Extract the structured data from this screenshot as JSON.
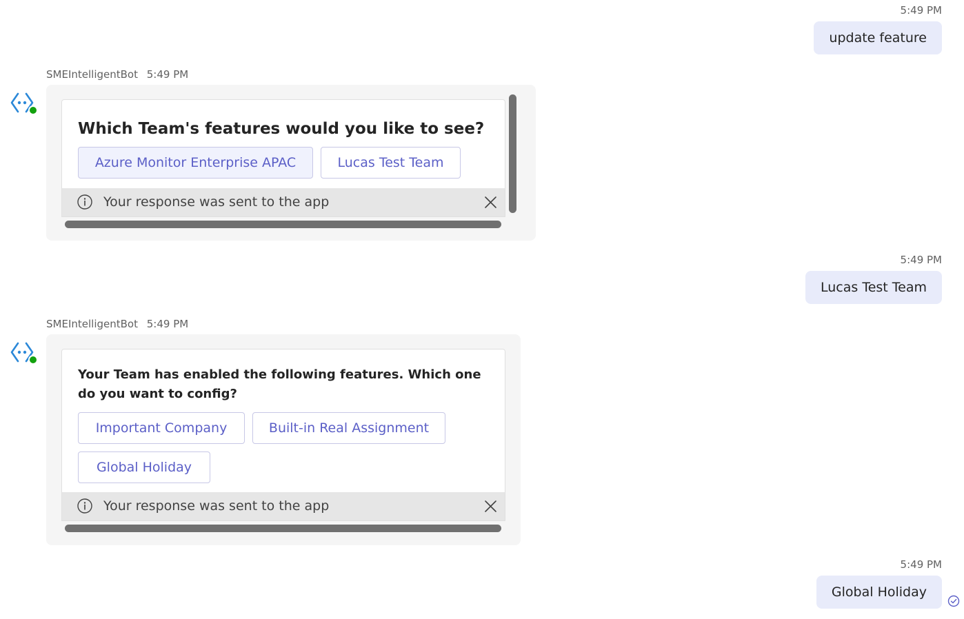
{
  "messages": [
    {
      "time": "5:49 PM",
      "text": "update feature"
    },
    {
      "time": "5:49 PM",
      "text": "Lucas Test Team"
    },
    {
      "time": "5:49 PM",
      "text": "Global Holiday"
    }
  ],
  "bot_cards": [
    {
      "sender": "SMEIntelligentBot",
      "time": "5:49 PM",
      "title": "Which Team's features would you like to see?",
      "buttons": [
        "Azure Monitor Enterprise APAC",
        "Lucas Test Team"
      ],
      "notice": "Your response was sent to the app"
    },
    {
      "sender": "SMEIntelligentBot",
      "time": "5:49 PM",
      "title": "Your Team has enabled the following features. Which one do you want to config?",
      "buttons": [
        "Important Company",
        "Built-in Real Assignment",
        "Global Holiday"
      ],
      "notice": "Your response was sent to the app"
    }
  ],
  "colors": {
    "bubble_out": "#e8ebfa",
    "button_text": "#5b5fc7",
    "status_online": "#13a10e"
  },
  "icons": [
    "bot-avatar-icon",
    "online-status-icon",
    "info-icon",
    "close-icon",
    "read-receipt-icon"
  ]
}
